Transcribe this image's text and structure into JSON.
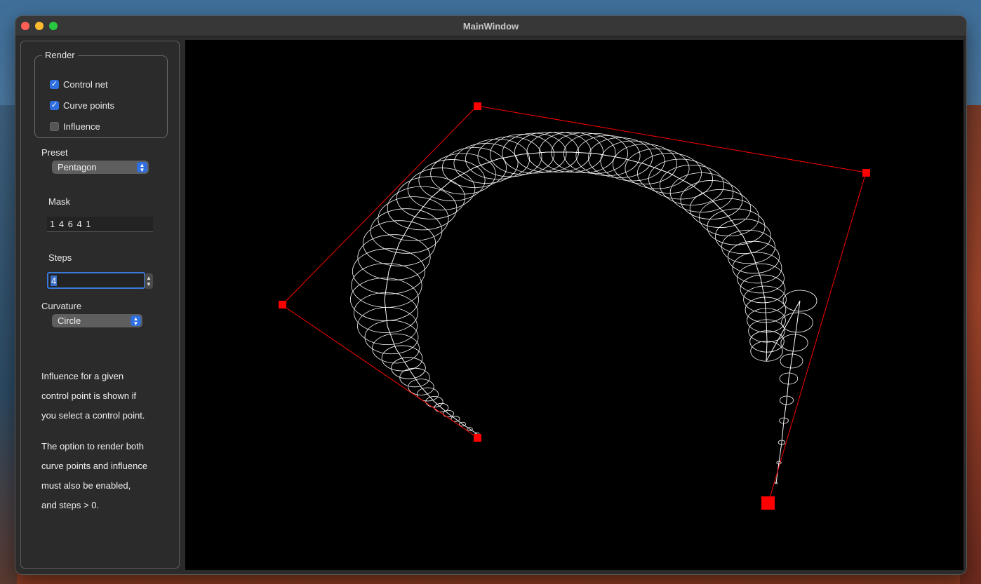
{
  "window": {
    "title": "MainWindow"
  },
  "render": {
    "group_title": "Render",
    "control_net": {
      "label": "Control net",
      "checked": true
    },
    "curve_points": {
      "label": "Curve points",
      "checked": true
    },
    "influence": {
      "label": "Influence",
      "checked": false
    }
  },
  "preset": {
    "label": "Preset",
    "value": "Pentagon"
  },
  "mask": {
    "label": "Mask",
    "value": "1 4 6 4 1"
  },
  "steps": {
    "label": "Steps",
    "value": "4"
  },
  "curvature": {
    "label": "Curvature",
    "value": "Circle"
  },
  "info": {
    "p1_l1": "Influence for a given",
    "p1_l2": "control point is shown if",
    "p1_l3": "you select a control point.",
    "p2_l1": "The option to render both",
    "p2_l2": "curve points and influence",
    "p2_l3": "must also be enabled,",
    "p2_l4": "and steps > 0."
  },
  "colors": {
    "control_net": "#ff0000",
    "curve": "#ffffff",
    "accent": "#2f6fe0",
    "canvas_bg": "#000000"
  },
  "icons": {
    "checkbox_checked": "checkmark-icon",
    "select": "chevron-updown-icon",
    "stepper": "stepper-arrows-icon"
  }
}
